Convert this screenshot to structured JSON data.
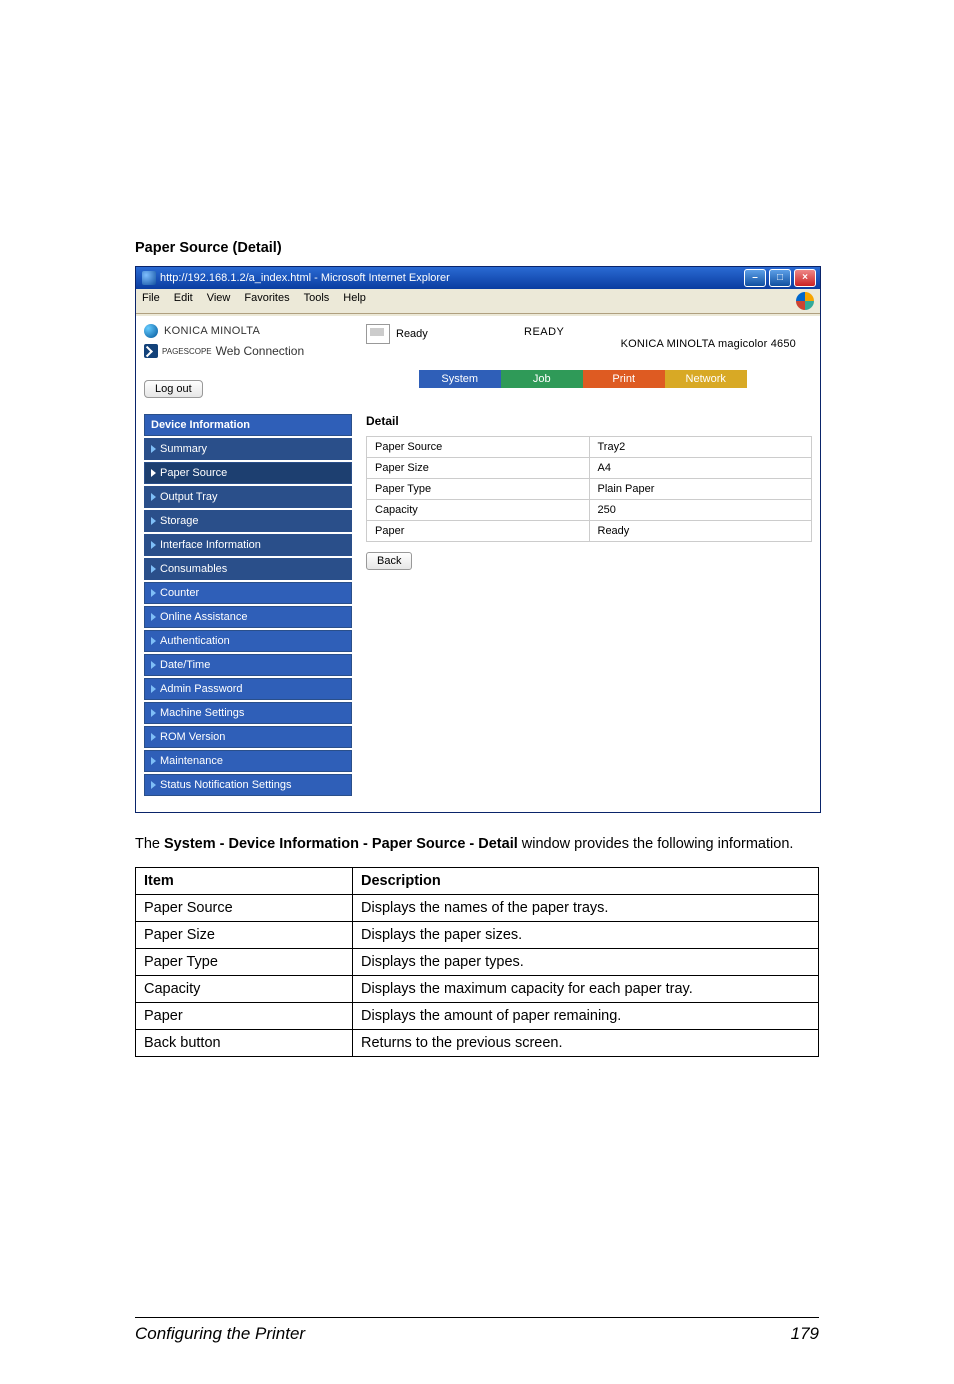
{
  "section_heading": "Paper Source (Detail)",
  "browser": {
    "title": "http://192.168.1.2/a_index.html - Microsoft Internet Explorer",
    "menus": [
      "File",
      "Edit",
      "View",
      "Favorites",
      "Tools",
      "Help"
    ]
  },
  "header": {
    "brand": "KONICA MINOLTA",
    "pagescope_prefix": "PAGESCOPE",
    "pagescope_name": "Web Connection",
    "status_label": "Ready",
    "ready_big": "READY",
    "model": "KONICA MINOLTA magicolor 4650"
  },
  "logout_label": "Log out",
  "tabs": {
    "system": "System",
    "job": "Job",
    "print": "Print",
    "network": "Network"
  },
  "nav": [
    {
      "label": "Device Information",
      "type": "header"
    },
    {
      "label": "Summary",
      "type": "sub"
    },
    {
      "label": "Paper Source",
      "type": "sub",
      "active": true
    },
    {
      "label": "Output Tray",
      "type": "sub"
    },
    {
      "label": "Storage",
      "type": "sub"
    },
    {
      "label": "Interface Information",
      "type": "sub"
    },
    {
      "label": "Consumables",
      "type": "sub"
    },
    {
      "label": "Counter",
      "type": "item"
    },
    {
      "label": "Online Assistance",
      "type": "item"
    },
    {
      "label": "Authentication",
      "type": "item"
    },
    {
      "label": "Date/Time",
      "type": "item"
    },
    {
      "label": "Admin Password",
      "type": "item"
    },
    {
      "label": "Machine Settings",
      "type": "item"
    },
    {
      "label": "ROM Version",
      "type": "item"
    },
    {
      "label": "Maintenance",
      "type": "item"
    },
    {
      "label": "Status Notification Settings",
      "type": "item"
    }
  ],
  "detail": {
    "title": "Detail",
    "rows": [
      {
        "label": "Paper Source",
        "value": "Tray2"
      },
      {
        "label": "Paper Size",
        "value": "A4"
      },
      {
        "label": "Paper Type",
        "value": "Plain Paper"
      },
      {
        "label": "Capacity",
        "value": "250"
      },
      {
        "label": "Paper",
        "value": "Ready"
      }
    ],
    "back_label": "Back"
  },
  "caption": {
    "prefix": "The ",
    "bold": "System - Device Information - Paper Source - Detail",
    "suffix": " window provides the following information."
  },
  "table": {
    "headers": [
      "Item",
      "Description"
    ],
    "rows": [
      [
        "Paper Source",
        "Displays the names of the paper trays."
      ],
      [
        "Paper Size",
        "Displays the paper sizes."
      ],
      [
        "Paper Type",
        "Displays the paper types."
      ],
      [
        "Capacity",
        "Displays the maximum capacity for each paper tray."
      ],
      [
        "Paper",
        "Displays the amount of paper remaining."
      ],
      [
        "Back button",
        "Returns to the previous screen."
      ]
    ]
  },
  "footer": {
    "left": "Configuring the Printer",
    "right": "179"
  }
}
